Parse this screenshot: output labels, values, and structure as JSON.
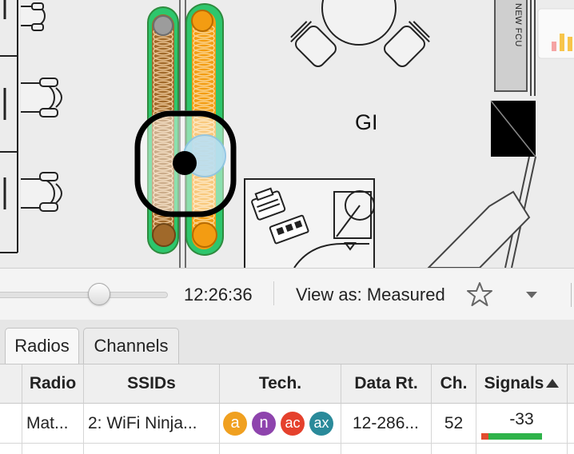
{
  "floorplan": {
    "room_label": "GI",
    "unit_label": "NEW FCU"
  },
  "timeline": {
    "slider_position_fraction": 0.6,
    "time": "12:26:36",
    "view_as": "View as: Measured"
  },
  "tabs": [
    {
      "label": "Radios",
      "active": true
    },
    {
      "label": "Channels",
      "active": false
    }
  ],
  "table": {
    "columns": [
      "Radio",
      "SSIDs",
      "Tech.",
      "Data Rt.",
      "Ch.",
      "Signals"
    ],
    "sorted_column": "Signals",
    "sort_direction": "ascending",
    "rows": [
      {
        "radio": "Mat...",
        "ssids": "2: WiFi Ninja...",
        "tech": [
          {
            "label": "a",
            "color": "#f0a020"
          },
          {
            "label": "n",
            "color": "#8e44ad"
          },
          {
            "label": "ac",
            "color": "#e5412d"
          },
          {
            "label": "ax",
            "color": "#2a8a9a"
          }
        ],
        "data_rate": "12-286...",
        "channel": "52",
        "signal": "-33"
      }
    ]
  },
  "icons": {
    "star": "star-outline-icon",
    "dropdown": "caret-down-icon"
  },
  "colors": {
    "trail_orange": "#f39c12",
    "trail_gray": "#9c9c9c",
    "marker_green": "#2ecc71",
    "selection_ring": "#000000",
    "signal_bar": "#2fb34a"
  }
}
